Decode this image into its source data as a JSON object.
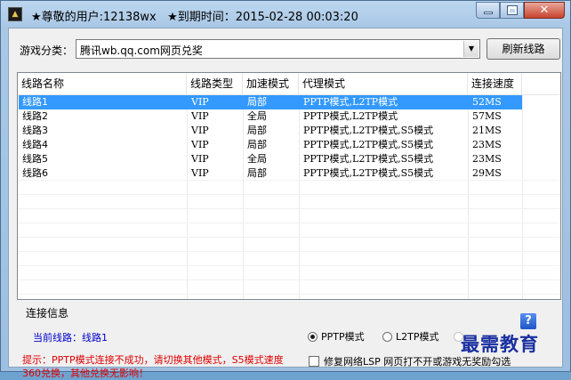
{
  "window": {
    "title": "★尊敬的用户:12138wx   ★到期时间：2015-02-28 00:03:20",
    "app_icon": "▲"
  },
  "toolbar": {
    "category_label": "游戏分类：",
    "category_value": "腾讯wb.qq.com网页兑奖",
    "refresh_button": "刷新线路"
  },
  "table": {
    "columns": [
      "线路名称",
      "线路类型",
      "加速模式",
      "代理模式",
      "连接速度"
    ],
    "rows": [
      {
        "name": "线路1",
        "type": "VIP",
        "accel": "局部",
        "proxy": "PPTP模式,L2TP模式",
        "speed": "52MS",
        "selected": true
      },
      {
        "name": "线路2",
        "type": "VIP",
        "accel": "全局",
        "proxy": "PPTP模式,L2TP模式",
        "speed": "57MS",
        "selected": false
      },
      {
        "name": "线路3",
        "type": "VIP",
        "accel": "局部",
        "proxy": "PPTP模式,L2TP模式,S5模式",
        "speed": "21MS",
        "selected": false
      },
      {
        "name": "线路4",
        "type": "VIP",
        "accel": "局部",
        "proxy": "PPTP模式,L2TP模式,S5模式",
        "speed": "23MS",
        "selected": false
      },
      {
        "name": "线路5",
        "type": "VIP",
        "accel": "全局",
        "proxy": "PPTP模式,L2TP模式,S5模式",
        "speed": "23MS",
        "selected": false
      },
      {
        "name": "线路6",
        "type": "VIP",
        "accel": "局部",
        "proxy": "PPTP模式,L2TP模式,S5模式",
        "speed": "29MS",
        "selected": false
      }
    ]
  },
  "info": {
    "title": "连接信息",
    "current_line": "当前线路：线路1",
    "tip": "提示：PPTP模式连接不成功，请切换其他模式，S5模式速度360兑换，其他兑换无影响！",
    "help": "?"
  },
  "modes": {
    "pptp": "PPTP模式",
    "l2tp": "L2TP模式",
    "selected": "pptp"
  },
  "options": {
    "repair_lsp": "修复网络LSP  网页打不开或游戏无奖励勾选"
  },
  "watermark": "最需教育",
  "colors": {
    "selection": "#3399ff",
    "tip_text": "#e00000",
    "info_text": "#0000cc"
  }
}
